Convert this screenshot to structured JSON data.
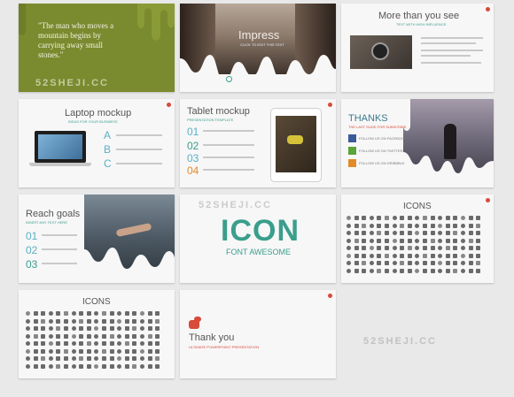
{
  "slide1": {
    "quote": "\"The man who moves a mountain begins by carrying away small stones.\""
  },
  "slide2": {
    "title": "Impress",
    "subtitle": "CLICK TO EDIT THIS TEXT"
  },
  "slide3": {
    "title": "More than you see",
    "subtitle": "TEXT WITH HIGH INFLUENCE"
  },
  "slide4": {
    "title": "Laptop mockup",
    "subtitle": "IDEAS FOR YOUR BUSINESS",
    "letters": [
      "A",
      "B",
      "C"
    ]
  },
  "slide5": {
    "title": "Tablet mockup",
    "subtitle": "PRESENTATION TEMPLATE",
    "numbers": [
      "01",
      "02",
      "03",
      "04"
    ]
  },
  "slide6": {
    "title": "THANKS",
    "subtitle": "THE LAST SLIDE FOR SUBSCRIBE",
    "items": [
      "FOLLOW US ON FACEBOOK",
      "FOLLOW US ON TWITTER",
      "FOLLOW US ON DRIBBBLE"
    ]
  },
  "slide7": {
    "title": "Reach goals",
    "subtitle": "INSERT ANY TEXT HERE",
    "numbers": [
      "01",
      "02",
      "03"
    ]
  },
  "slide8": {
    "title": "ICON",
    "subtitle": "FONT AWESOME"
  },
  "slide9": {
    "title": "ICONS"
  },
  "slide10": {
    "title": "ICONS"
  },
  "slide11": {
    "title": "Thank you",
    "subtitle": "ULTIMATE POWERPOINT PRESENTATION"
  },
  "watermark": {
    "text": "52SHEJI.CC"
  },
  "colors": {
    "olive": "#7a8a2e",
    "teal": "#3a9e8c",
    "blue": "#5bb0c6",
    "red": "#d84a3a"
  }
}
